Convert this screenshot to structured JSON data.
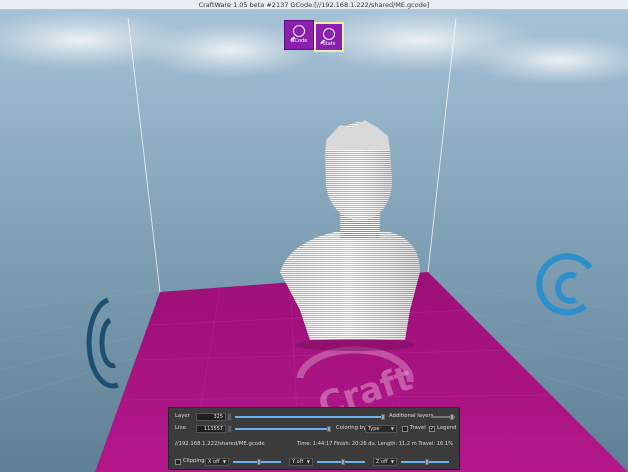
{
  "window": {
    "title": "CraftWare 1.05 beta #2137   GCode:[//192.168.1.222/shared/ME.gcode]"
  },
  "toolbar": {
    "gcode_label": "GCode",
    "stats_label": "Stats"
  },
  "scene": {
    "bed_color": "#a5137d",
    "bed_watermark": "Craft"
  },
  "panel": {
    "layer_label": "Layer",
    "layer_value": "325",
    "additional_layers_label": "Additional layers",
    "line_label": "Line",
    "line_value": "113557",
    "coloring_by_label": "Coloring by",
    "coloring_by_value": "Type",
    "travel_label": "Travel",
    "travel_checked": false,
    "legend_label": "Legend",
    "legend_checked": true,
    "file_path": "//192.168.1.222/shared/ME.gcode",
    "stats_text": "Time: 1:44:17  Finish: 20:26 du.  Length: 11.2 m  Travel: 16.1%",
    "clipping_label": "Clipping",
    "clip_x_value": "X off",
    "clip_y_value": "Y off",
    "clip_z_value": "Z off"
  },
  "colors": {
    "accent": "#8a1fb0",
    "bed": "#a5137d",
    "slider": "#69b3f5"
  }
}
